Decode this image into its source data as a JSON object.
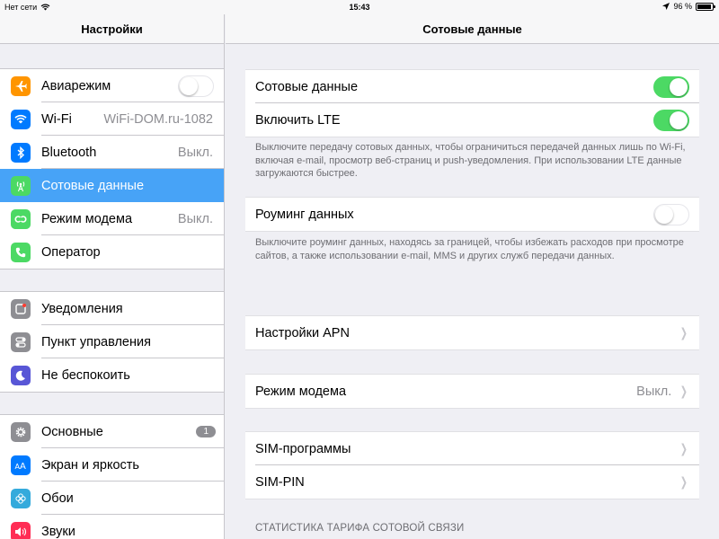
{
  "status": {
    "carrier": "Нет сети",
    "time": "15:43",
    "battery": "96 %",
    "battery_level": 0.96
  },
  "master": {
    "title": "Настройки",
    "groups": [
      [
        {
          "label": "Авиарежим",
          "icon": "airplane-icon",
          "color": "#ff9500",
          "toggle": false
        },
        {
          "label": "Wi-Fi",
          "value": "WiFi-DOM.ru-1082",
          "icon": "wifi-icon",
          "color": "#007aff"
        },
        {
          "label": "Bluetooth",
          "value": "Выкл.",
          "icon": "bluetooth-icon",
          "color": "#007aff"
        },
        {
          "label": "Сотовые данные",
          "icon": "cellular-icon",
          "color": "#4cd964",
          "selected": true
        },
        {
          "label": "Режим модема",
          "value": "Выкл.",
          "icon": "hotspot-icon",
          "color": "#4cd964"
        },
        {
          "label": "Оператор",
          "icon": "phone-icon",
          "color": "#4cd964"
        }
      ],
      [
        {
          "label": "Уведомления",
          "icon": "notifications-icon",
          "color": "#8e8e93"
        },
        {
          "label": "Пункт управления",
          "icon": "control-center-icon",
          "color": "#8e8e93"
        },
        {
          "label": "Не беспокоить",
          "icon": "moon-icon",
          "color": "#5856d6"
        }
      ],
      [
        {
          "label": "Основные",
          "badge": "1",
          "icon": "gear-icon",
          "color": "#8e8e93"
        },
        {
          "label": "Экран и яркость",
          "icon": "display-icon",
          "color": "#007aff"
        },
        {
          "label": "Обои",
          "icon": "wallpaper-icon",
          "color": "#34aadc"
        },
        {
          "label": "Звуки",
          "icon": "sounds-icon",
          "color": "#ff2d55"
        }
      ]
    ]
  },
  "detail": {
    "title": "Сотовые данные",
    "cellular_data": {
      "label": "Сотовые данные",
      "on": true
    },
    "lte": {
      "label": "Включить LTE",
      "on": true
    },
    "note1": "Выключите передачу сотовых данных, чтобы ограничиться передачей данных лишь по Wi-Fi, включая e-mail, просмотр веб-страниц и push-уведомления. При использовании LTE данные загружаются быстрее.",
    "roaming": {
      "label": "Роуминг данных",
      "on": false
    },
    "note2": "Выключите роуминг данных, находясь за границей, чтобы избежать расходов при просмотре сайтов, а также использовании e-mail, MMS и других служб передачи данных.",
    "apn": {
      "label": "Настройки APN"
    },
    "hotspot": {
      "label": "Режим модема",
      "value": "Выкл."
    },
    "sim_apps": {
      "label": "SIM-программы"
    },
    "sim_pin": {
      "label": "SIM-PIN"
    },
    "stats_header": "СТАТИСТИКА ТАРИФА СОТОВОЙ СВЯЗИ"
  }
}
